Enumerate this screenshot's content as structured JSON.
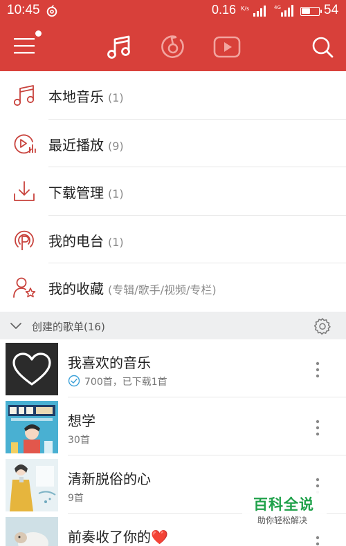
{
  "status_bar": {
    "time": "10:45",
    "speed": "0.16",
    "speed_unit": "K/s",
    "network": "4G",
    "battery_level": "54",
    "battery_fraction": 0.54
  },
  "app_bar": {
    "icons": [
      "menu-icon",
      "music-note-icon",
      "netease-radio-icon",
      "video-play-icon",
      "search-icon"
    ],
    "accent_color": "#d8403a"
  },
  "menu": {
    "items": [
      {
        "label": "本地音乐",
        "count": "(1)",
        "icon": "music-note-icon"
      },
      {
        "label": "最近播放",
        "count": "(9)",
        "icon": "recent-play-icon"
      },
      {
        "label": "下载管理",
        "count": "(1)",
        "icon": "download-icon"
      },
      {
        "label": "我的电台",
        "count": "(1)",
        "icon": "podcast-icon"
      },
      {
        "label": "我的收藏",
        "count": "(专辑/歌手/视频/专栏)",
        "icon": "favorites-icon"
      }
    ]
  },
  "playlist_section": {
    "title": "创建的歌单(16)"
  },
  "playlists": [
    {
      "name": "我喜欢的音乐",
      "sub": "700首，已下载1首"
    },
    {
      "name": "想学",
      "sub": "30首"
    },
    {
      "name": "清新脱俗的心",
      "sub": "9首"
    },
    {
      "name": "前奏收了你的❤️",
      "sub": ""
    }
  ],
  "watermark": {
    "title": "百科全说",
    "subtitle": "助你轻松解决"
  }
}
